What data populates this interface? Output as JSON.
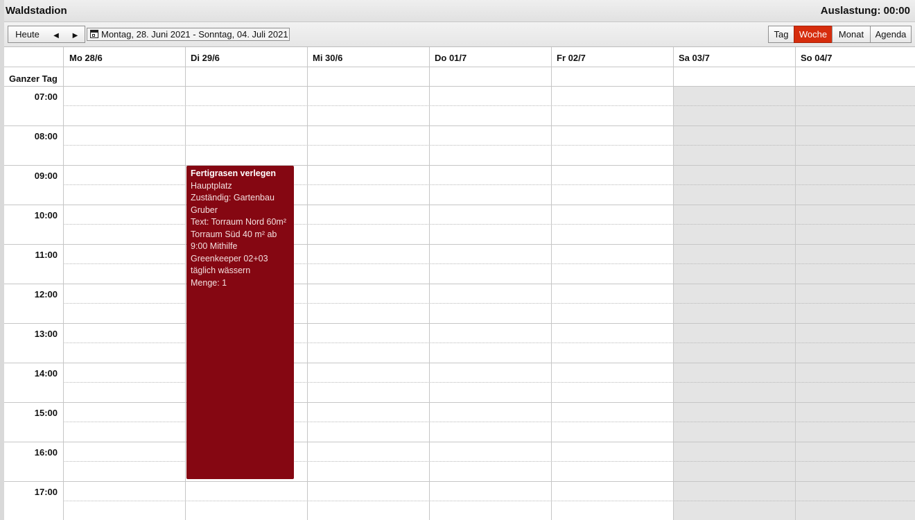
{
  "header": {
    "title": "Waldstadion",
    "utilization": "Auslastung: 00:00"
  },
  "toolbar": {
    "today_label": "Heute",
    "prev_icon": "◀",
    "next_icon": "▶",
    "date_range": "Montag, 28. Juni 2021 - Sonntag, 04. Juli 2021",
    "views": [
      "Tag",
      "Woche",
      "Monat",
      "Agenda"
    ],
    "active_view": "Woche",
    "accent_color": "#d62d0d"
  },
  "calendar": {
    "all_day_label": "Ganzer Tag",
    "days": [
      "Mo 28/6",
      "Di 29/6",
      "Mi 30/6",
      "Do 01/7",
      "Fr 02/7",
      "Sa 03/7",
      "So 04/7"
    ],
    "hours": [
      "07:00",
      "08:00",
      "09:00",
      "10:00",
      "11:00",
      "12:00",
      "13:00",
      "14:00",
      "15:00",
      "16:00",
      "17:00"
    ],
    "weekend_color": "#e4e4e4"
  },
  "event": {
    "title": "Fertigrasen verlegen",
    "lines": [
      "Hauptplatz",
      "Zuständig: Gartenbau",
      "Gruber",
      "Text: Torraum Nord 60m²",
      "Torraum Süd 40 m² ab",
      "9:00 Mithilfe",
      "Greenkeeper 02+03",
      "täglich wässern",
      "Menge: 1"
    ],
    "day": "Di 29/6",
    "start": "09:00",
    "end": "17:00",
    "color": "#850712"
  }
}
